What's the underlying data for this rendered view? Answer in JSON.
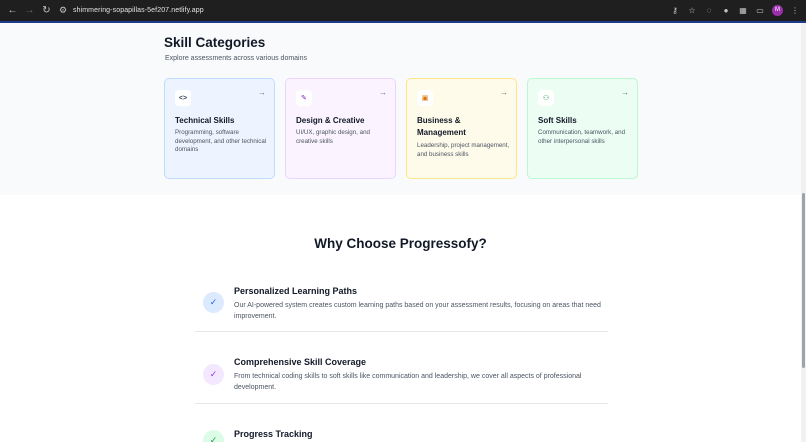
{
  "browser": {
    "url": "shimmering-sopapillas-5ef207.netlify.app",
    "avatar_letter": "M"
  },
  "skills": {
    "heading": "Skill Categories",
    "subheading": "Explore assessments across various domains",
    "cards": [
      {
        "icon": "code-icon",
        "icon_glyph": "<>",
        "title": "Technical Skills",
        "description": "Programming, software development, and other technical domains",
        "accent": "#bfdbfe"
      },
      {
        "icon": "pen-tool-icon",
        "icon_glyph": "✎",
        "title": "Design & Creative",
        "description": "UI/UX, graphic design, and creative skills",
        "accent": "#e9d5ff"
      },
      {
        "icon": "briefcase-icon",
        "icon_glyph": "▣",
        "title": "Business & Management",
        "description": "Leadership, project management, and business skills",
        "accent": "#fde68a"
      },
      {
        "icon": "users-icon",
        "icon_glyph": "⚇",
        "title": "Soft Skills",
        "description": "Communication, teamwork, and other interpersonal skills",
        "accent": "#bbf7d0"
      }
    ]
  },
  "why": {
    "heading": "Why Choose Progressofy?",
    "features": [
      {
        "icon": "check-circle-icon",
        "title": "Personalized Learning Paths",
        "description": "Our AI-powered system creates custom learning paths based on your assessment results, focusing on areas that need improvement.",
        "color": "#2563eb"
      },
      {
        "icon": "check-circle-icon",
        "title": "Comprehensive Skill Coverage",
        "description": "From technical coding skills to soft skills like communication and leadership, we cover all aspects of professional development.",
        "color": "#9333ea"
      },
      {
        "icon": "check-circle-icon",
        "title": "Progress Tracking",
        "description": "",
        "color": "#16a34a"
      }
    ]
  }
}
